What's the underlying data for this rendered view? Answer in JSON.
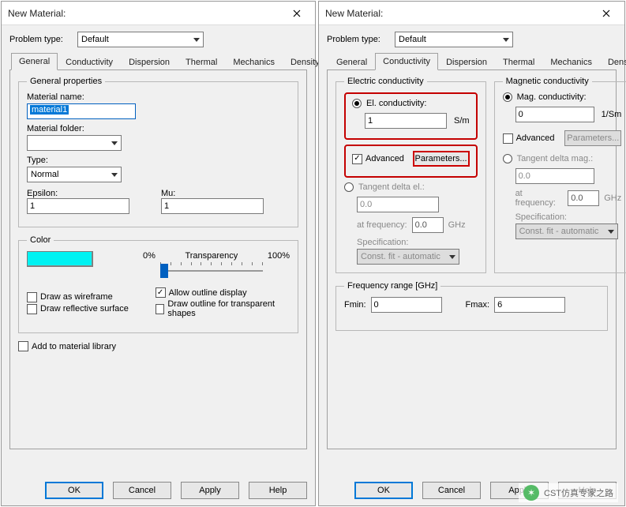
{
  "dialog_title": "New Material:",
  "close_tooltip": "Close",
  "problem_type_label": "Problem type:",
  "problem_type_value": "Default",
  "tabs": {
    "general": "General",
    "conductivity": "Conductivity",
    "dispersion": "Dispersion",
    "thermal": "Thermal",
    "mechanics": "Mechanics",
    "density": "Density"
  },
  "general": {
    "group_title": "General properties",
    "material_name_label": "Material name:",
    "material_name_value": "material1",
    "material_folder_label": "Material folder:",
    "material_folder_value": "",
    "type_label": "Type:",
    "type_value": "Normal",
    "epsilon_label": "Epsilon:",
    "epsilon_value": "1",
    "mu_label": "Mu:",
    "mu_value": "1",
    "color_group": "Color",
    "color_swatch": "#00f2f2",
    "transparency_0": "0%",
    "transparency_label": "Transparency",
    "transparency_100": "100%",
    "draw_wireframe": "Draw as wireframe",
    "draw_reflective": "Draw reflective surface",
    "allow_outline": "Allow outline display",
    "draw_outline_transparent": "Draw outline for transparent shapes",
    "add_lib": "Add to material library"
  },
  "cond": {
    "elec_group": "Electric conductivity",
    "mag_group": "Magnetic conductivity",
    "el_cond_radio": "El. conductivity:",
    "el_cond_value": "1",
    "el_cond_unit": "S/m",
    "mag_cond_radio": "Mag. conductivity:",
    "mag_cond_value": "0",
    "mag_cond_unit": "1/Sm",
    "advanced": "Advanced",
    "parameters_btn": "Parameters...",
    "tan_el_radio": "Tangent delta el.:",
    "tan_el_value": "0.0",
    "tan_mag_radio": "Tangent delta mag.:",
    "tan_mag_value": "0.0",
    "at_freq": "at frequency:",
    "at_freq_value": "0.0",
    "ghz": "GHz",
    "spec_label": "Specification:",
    "spec_value": "Const. fit - automatic",
    "freq_group": "Frequency range [GHz]",
    "fmin_label": "Fmin:",
    "fmin_value": "0",
    "fmax_label": "Fmax:",
    "fmax_value": "6"
  },
  "buttons": {
    "ok": "OK",
    "cancel": "Cancel",
    "apply": "Apply",
    "help": "Help"
  },
  "watermark": "CST仿真专家之路"
}
